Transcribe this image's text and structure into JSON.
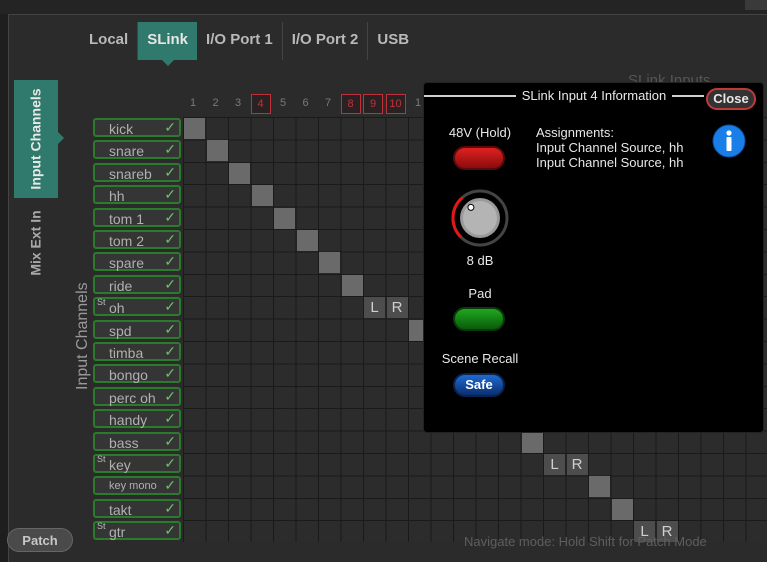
{
  "tabs": [
    {
      "label": "Local",
      "active": false
    },
    {
      "label": "SLink",
      "active": true
    },
    {
      "label": "I/O Port 1",
      "active": false
    },
    {
      "label": "I/O Port 2",
      "active": false
    },
    {
      "label": "USB",
      "active": false
    }
  ],
  "side_tabs": [
    {
      "label": "Input Channels",
      "active": true
    },
    {
      "label": "Mix Ext In",
      "active": false
    }
  ],
  "axis_label": "Input Channels",
  "column_header_partial": "SLink Inputs",
  "column_numbers": [
    "1",
    "2",
    "3",
    "4",
    "5",
    "6",
    "7",
    "8",
    "9",
    "10",
    "1"
  ],
  "highlighted_columns": [
    "4",
    "8",
    "9",
    "10"
  ],
  "channels": [
    {
      "name": "kick",
      "stereo": ""
    },
    {
      "name": "snare",
      "stereo": ""
    },
    {
      "name": "snareb",
      "stereo": ""
    },
    {
      "name": "hh",
      "stereo": ""
    },
    {
      "name": "tom 1",
      "stereo": ""
    },
    {
      "name": "tom 2",
      "stereo": ""
    },
    {
      "name": "spare",
      "stereo": ""
    },
    {
      "name": "ride",
      "stereo": ""
    },
    {
      "name": "oh",
      "stereo": "St"
    },
    {
      "name": "spd",
      "stereo": ""
    },
    {
      "name": "timba",
      "stereo": ""
    },
    {
      "name": "bongo",
      "stereo": ""
    },
    {
      "name": "perc oh",
      "stereo": ""
    },
    {
      "name": "handy",
      "stereo": ""
    },
    {
      "name": "bass",
      "stereo": ""
    },
    {
      "name": "key",
      "stereo": "St"
    },
    {
      "name": "key mono",
      "stereo": ""
    },
    {
      "name": "takt",
      "stereo": ""
    },
    {
      "name": "gtr",
      "stereo": "St"
    }
  ],
  "check_glyph": "✓",
  "lr_labels": {
    "left": "L",
    "right": "R"
  },
  "patch_button": "Patch",
  "nav_hint": "Navigate mode: Hold Shift for Patch Mode",
  "popup": {
    "title": "SLink Input 4 Information",
    "close_label": "Close",
    "phantom_label": "48V (Hold)",
    "gain_value": "8 dB",
    "gain_fraction": 0.35,
    "pad_label": "Pad",
    "scene_recall_label": "Scene Recall",
    "safe_label": "Safe",
    "assignments_heading": "Assignments:",
    "assignments": [
      "Input Channel Source, hh",
      "Input Channel Source, hh"
    ],
    "info_icon": "info-icon"
  },
  "colors": {
    "accent_teal": "#2f7a6c",
    "channel_border_green": "#2c7a2c",
    "highlight_red": "#c0303a",
    "phantom_red": "#e02020",
    "pad_green": "#1fa81f",
    "safe_blue": "#1e6ad0",
    "info_blue": "#1a7ee8"
  }
}
